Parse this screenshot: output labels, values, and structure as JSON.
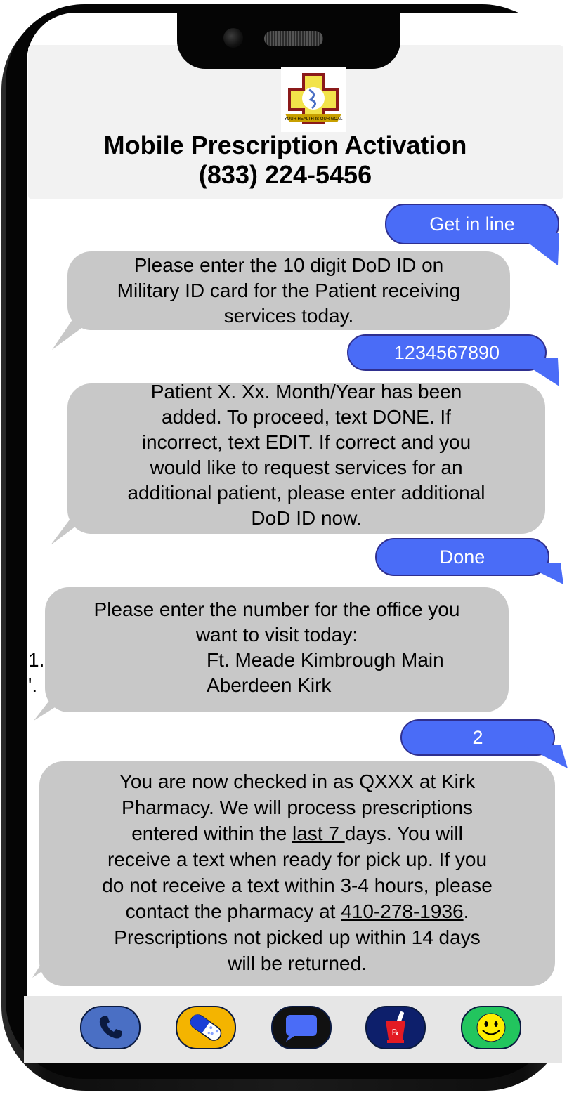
{
  "app": {
    "title": "Mobile Prescription Activation",
    "phone_number": "(833) 224-5456",
    "logo_motto": "YOUR HEALTH IS OUR GOAL"
  },
  "messages": [
    {
      "dir": "out",
      "text": "Get in line"
    },
    {
      "dir": "in",
      "lines": [
        "Please enter the 10 digit DoD ID on",
        "Military ID card for the Patient receiving",
        "services today."
      ]
    },
    {
      "dir": "out",
      "text": "1234567890"
    },
    {
      "dir": "in",
      "lines": [
        "Patient X. Xx. Month/Year has been",
        "added. To proceed, text DONE. If",
        "incorrect, text EDIT. If correct and you",
        "would like to request services for an",
        "additional patient, please enter additional",
        "DoD ID now."
      ]
    },
    {
      "dir": "out",
      "text": "Done"
    },
    {
      "dir": "in",
      "lines": [
        "Please enter the number for the office you",
        "want to visit today:"
      ],
      "options": [
        {
          "num": "1.",
          "label": "Ft. Meade Kimbrough Main"
        },
        {
          "num": "'.",
          "label": "Aberdeen Kirk"
        }
      ]
    },
    {
      "dir": "out",
      "text": "2"
    },
    {
      "dir": "in",
      "lines": [
        "You are now checked in as QXXX at Kirk",
        "Pharmacy. We will process prescriptions"
      ],
      "line3_pre": "entered within the ",
      "line3_u": "last 7 ",
      "line3_post": "days. You will",
      "lines_mid": [
        "receive a text when ready for pick up. If you",
        "do not receive a text within 3-4 hours, please"
      ],
      "line6_pre": "contact the pharmacy at ",
      "line6_u": "410-278-1936",
      "line6_post": ".",
      "lines_end": [
        "Prescriptions not picked up within 14 days",
        "will be returned."
      ]
    }
  ],
  "dock": {
    "items": [
      "phone-icon",
      "pill-icon",
      "chat-icon",
      "pharmacy-icon",
      "smiley-icon"
    ],
    "colors": [
      "#4a6fc4",
      "#f4b400",
      "#1a1a1a",
      "#0d1f6b",
      "#22c55e"
    ]
  }
}
